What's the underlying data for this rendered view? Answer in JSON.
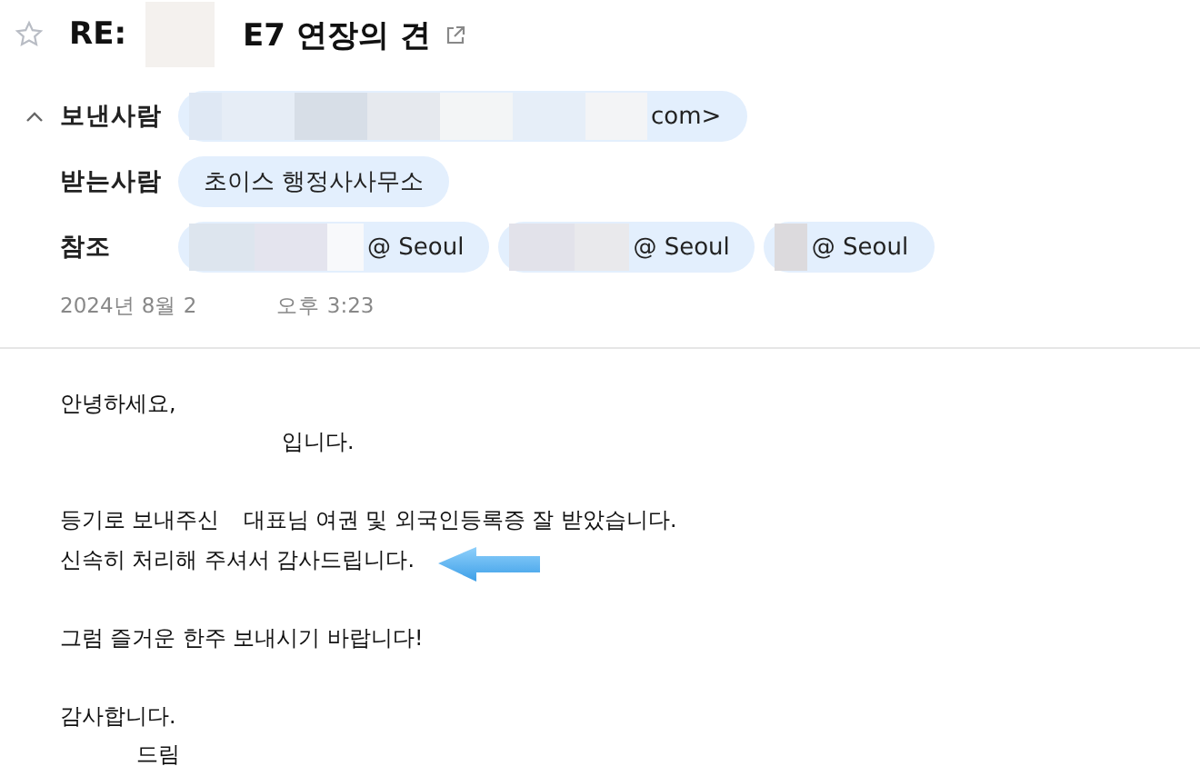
{
  "message": {
    "starred": false,
    "subject_prefix": "RE:",
    "subject": "E7 연장의 견"
  },
  "header": {
    "expanded": true,
    "rows": [
      {
        "label": "보낸사람",
        "chips": [
          {
            "text": "com>",
            "redacted": true
          }
        ]
      },
      {
        "label": "받는사람",
        "chips": [
          {
            "text": "초이스 행정사사무소",
            "redacted": false
          }
        ]
      },
      {
        "label": "참조",
        "chips": [
          {
            "text": "@ Seoul",
            "redacted": true
          },
          {
            "text": "@ Seoul",
            "redacted": true
          },
          {
            "text": "@ Seoul",
            "redacted": true
          }
        ]
      }
    ],
    "date_start": "2024년 8월 2",
    "date_end": "오후 3:23"
  },
  "body": [
    {
      "kind": "plain",
      "parts": [
        "안녕하세요,"
      ]
    },
    {
      "kind": "intro",
      "parts": [
        "입니다."
      ]
    },
    {
      "kind": "blank"
    },
    {
      "kind": "plain",
      "parts": [
        "등기로 보내주신",
        "대표님 여권 및 외국인등록증 잘 받았습니다."
      ]
    },
    {
      "kind": "plain",
      "parts": [
        "신속히 처리해 주셔서 감사드립니다."
      ],
      "arrow": true
    },
    {
      "kind": "blank"
    },
    {
      "kind": "plain",
      "parts": [
        "그럼 즐거운 한주 보내시기 바랍니다!"
      ]
    },
    {
      "kind": "blank"
    },
    {
      "kind": "plain",
      "parts": [
        "감사합니다."
      ]
    },
    {
      "kind": "signature",
      "parts": [
        "드림"
      ]
    }
  ]
}
